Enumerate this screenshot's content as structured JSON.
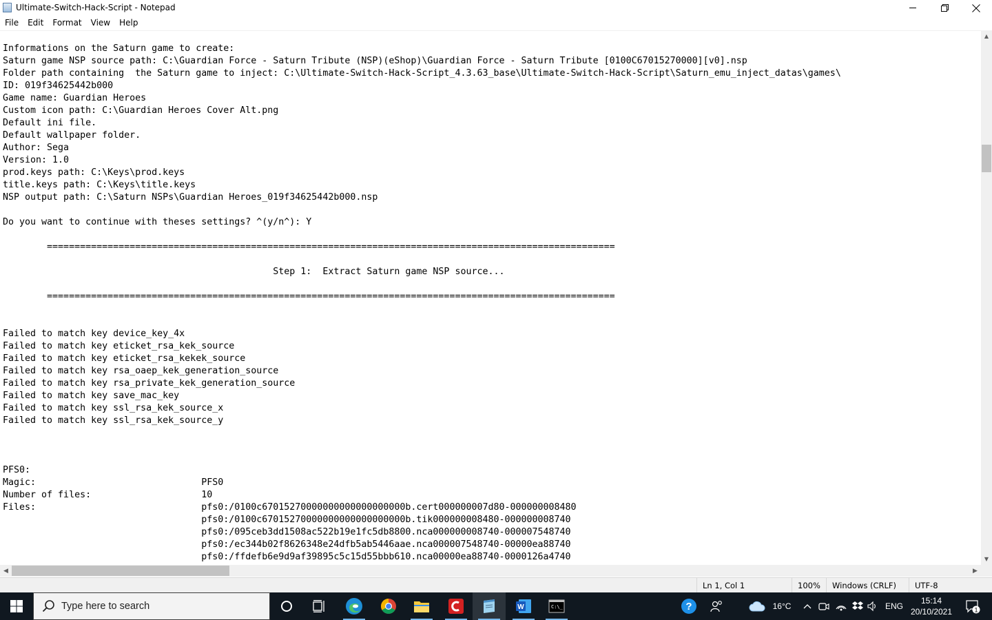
{
  "window": {
    "title": "Ultimate-Switch-Hack-Script - Notepad",
    "minimize_icon": "minimize-icon",
    "restore_icon": "restore-icon",
    "close_icon": "close-icon"
  },
  "menu": {
    "items": [
      "File",
      "Edit",
      "Format",
      "View",
      "Help"
    ]
  },
  "editor": {
    "lines": [
      "Informations on the Saturn game to create:",
      "Saturn game NSP source path: C:\\Guardian Force - Saturn Tribute (NSP)(eShop)\\Guardian Force - Saturn Tribute [0100C67015270000][v0].nsp",
      "Folder path containing  the Saturn game to inject: C:\\Ultimate-Switch-Hack-Script_4.3.63_base\\Ultimate-Switch-Hack-Script\\Saturn_emu_inject_datas\\games\\",
      "ID: 019f34625442b000",
      "Game name: Guardian Heroes",
      "Custom icon path: C:\\Guardian Heroes Cover Alt.png",
      "Default ini file.",
      "Default wallpaper folder.",
      "Author: Sega",
      "Version: 1.0",
      "prod.keys path: C:\\Keys\\prod.keys",
      "title.keys path: C:\\Keys\\title.keys",
      "NSP output path: C:\\Saturn NSPs\\Guardian Heroes_019f34625442b000.nsp",
      "",
      "Do you want to continue with theses settings? ^(y/n^): Y",
      "",
      "        =======================================================================================================",
      "",
      "                                                 Step 1:  Extract Saturn game NSP source...",
      "",
      "        =======================================================================================================",
      "",
      "",
      "Failed to match key device_key_4x",
      "Failed to match key eticket_rsa_kek_source",
      "Failed to match key eticket_rsa_kekek_source",
      "Failed to match key rsa_oaep_kek_generation_source",
      "Failed to match key rsa_private_kek_generation_source",
      "Failed to match key save_mac_key",
      "Failed to match key ssl_rsa_kek_source_x",
      "Failed to match key ssl_rsa_kek_source_y",
      "",
      "",
      "",
      "PFS0:",
      "Magic:                              PFS0",
      "Number of files:                    10",
      "Files:                              pfs0:/0100c67015270000000000000000000b.cert000000007d80-000000008480",
      "                                    pfs0:/0100c67015270000000000000000000b.tik000000008480-000000008740",
      "                                    pfs0:/095ceb3dd1508ac522b19e1fc5db8800.nca000000008740-000007548740",
      "                                    pfs0:/ec344b02f8626348e24dfb5ab5446aae.nca000007548740-00000ea88740",
      "                                    pfs0:/ffdefb6e9d9af39895c5c15d55bbb610.nca00000ea88740-0000126a4740"
    ]
  },
  "status": {
    "position": "Ln 1, Col 1",
    "zoom": "100%",
    "line_endings": "Windows (CRLF)",
    "encoding": "UTF-8"
  },
  "taskbar": {
    "search_placeholder": "Type here to search",
    "temperature": "16°C",
    "language": "ENG",
    "time": "15:14",
    "date": "20/10/2021",
    "notification_count": "1"
  }
}
